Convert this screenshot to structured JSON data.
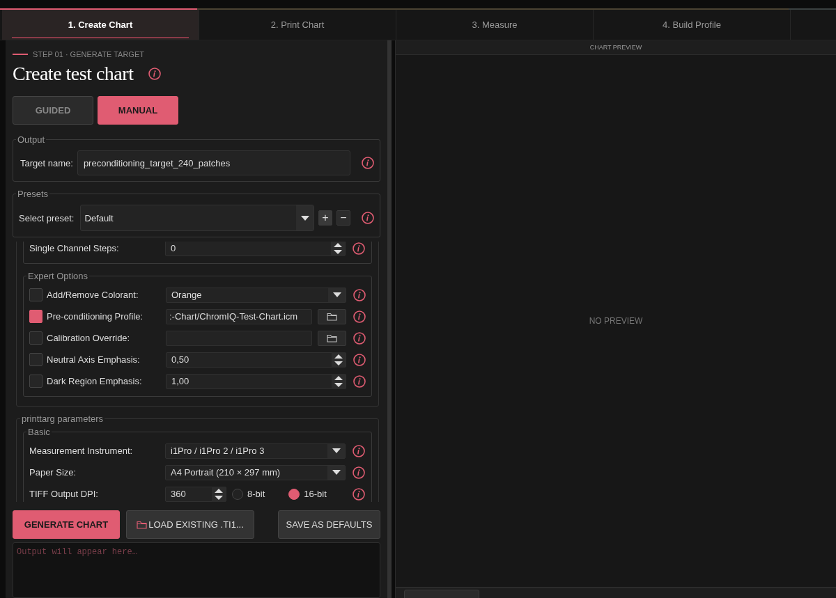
{
  "tabs": [
    {
      "label": "1. Create Chart",
      "selected": true
    },
    {
      "label": "2. Print Chart",
      "selected": false
    },
    {
      "label": "3. Measure",
      "selected": false
    },
    {
      "label": "4. Build Profile",
      "selected": false
    }
  ],
  "step_label": "STEP 01 · GENERATE TARGET",
  "title": "Create test chart",
  "mode_buttons": [
    {
      "label": "GUIDED",
      "selected": false
    },
    {
      "label": "MANUAL",
      "selected": true
    }
  ],
  "output_group": {
    "legend": "Output",
    "label": "Target name:",
    "value": "preconditioning_target_240_patches"
  },
  "presets_group": {
    "legend": "Presets",
    "label": "Select preset:",
    "value": "Default",
    "buttons": [
      {
        "kind": "add",
        "label": "+"
      },
      {
        "kind": "remove",
        "label": "−"
      }
    ]
  },
  "partial_group": {
    "rows": [
      {
        "kind": "spin",
        "label": "Single Channel Steps:",
        "value": "0"
      }
    ]
  },
  "expert_options": {
    "legend": "Expert Options",
    "rows": [
      {
        "kind": "select",
        "checked": false,
        "label": "Add/Remove Colorant:",
        "value": "Orange"
      },
      {
        "kind": "file",
        "checked": true,
        "label": "Pre-conditioning Profile:",
        "value": ":-Chart/ChromIQ-Test-Chart.icm"
      },
      {
        "kind": "file",
        "checked": false,
        "label": "Calibration Override:"
      },
      {
        "kind": "spin",
        "checked": false,
        "label": "Neutral Axis Emphasis:",
        "value": "0,50"
      },
      {
        "kind": "spin",
        "checked": false,
        "label": "Dark Region Emphasis:",
        "value": "1,00"
      }
    ]
  },
  "printtarg": {
    "legend": "printtarg parameters",
    "basic": {
      "legend": "Basic",
      "rows": [
        {
          "kind": "select",
          "label": "Measurement Instrument:",
          "value": "i1Pro / i1Pro 2 / i1Pro 3"
        },
        {
          "kind": "select",
          "label": "Paper Size:",
          "value": "A4 Portrait (210 × 297 mm)"
        },
        {
          "kind": "dpi",
          "label": "TIFF Output DPI:",
          "value": "360",
          "options": [
            {
              "label": "8-bit",
              "selected": false
            },
            {
              "label": "16-bit",
              "selected": true
            }
          ]
        }
      ]
    }
  },
  "actions": [
    {
      "kind": "primary",
      "label": "GENERATE CHART"
    },
    {
      "kind": "folder",
      "label": "LOAD EXISTING .TI1..."
    },
    {
      "kind": "plain",
      "label": "SAVE AS DEFAULTS"
    }
  ],
  "output_log": {
    "placeholder": "Output will appear here…"
  },
  "preview": {
    "header": "CHART PREVIEW",
    "message": "NO PREVIEW"
  }
}
